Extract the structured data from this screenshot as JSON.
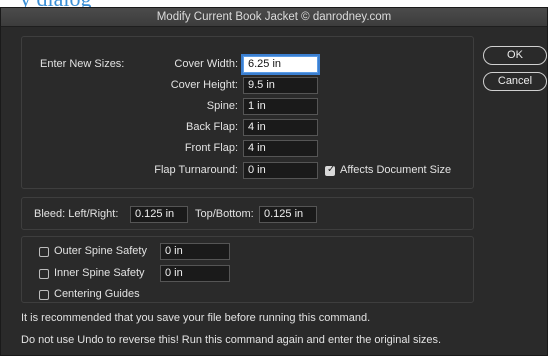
{
  "dialog": {
    "title": "Modify Current Book Jacket © danrodney.com"
  },
  "sizes": {
    "heading": "Enter New Sizes:",
    "cover_width": {
      "label": "Cover Width:",
      "value": "6.25 in"
    },
    "cover_height": {
      "label": "Cover Height:",
      "value": "9.5 in"
    },
    "spine": {
      "label": "Spine:",
      "value": "1 in"
    },
    "back_flap": {
      "label": "Back Flap:",
      "value": "4 in"
    },
    "front_flap": {
      "label": "Front Flap:",
      "value": "4 in"
    },
    "flap_turnaround": {
      "label": "Flap Turnaround:",
      "value": "0 in"
    },
    "affects_document_size": {
      "label": "Affects Document Size",
      "checked": true
    }
  },
  "bleed": {
    "left_right": {
      "label": "Bleed: Left/Right:",
      "value": "0.125 in"
    },
    "top_bottom": {
      "label": "Top/Bottom:",
      "value": "0.125 in"
    }
  },
  "safety": {
    "outer_spine": {
      "label": "Outer Spine Safety",
      "value": "0 in",
      "checked": false
    },
    "inner_spine": {
      "label": "Inner Spine Safety",
      "value": "0 in",
      "checked": false
    },
    "centering_guides": {
      "label": "Centering Guides",
      "checked": false
    }
  },
  "buttons": {
    "ok": "OK",
    "cancel": "Cancel"
  },
  "notes": {
    "line1": "It is recommended that you save your file before running this command.",
    "line2": "Do not use Undo to reverse this! Run this command again and enter the original sizes."
  },
  "colors": {
    "dialog_bg": "#2a2a2a",
    "focus_ring": "#3b7fd0"
  }
}
